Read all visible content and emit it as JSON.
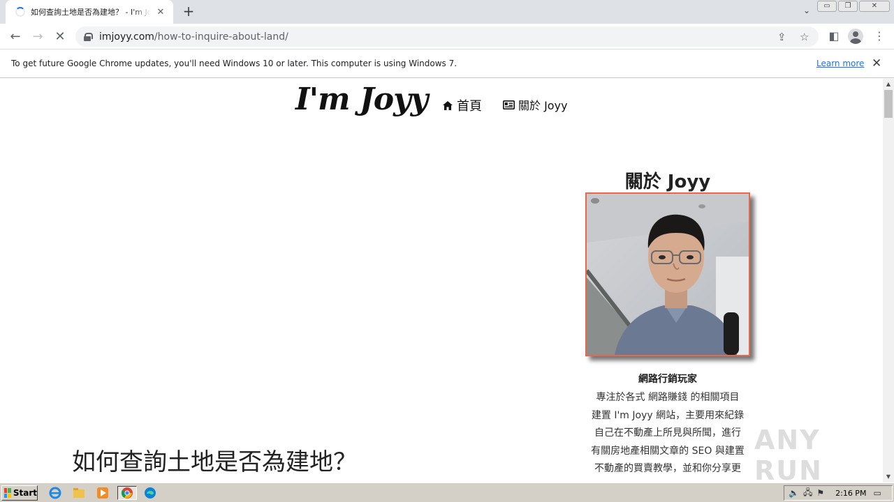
{
  "browser": {
    "tab_title": "如何查詢土地是否為建地？ - I'm Joyy",
    "tab_close": "✕",
    "new_tab": "+",
    "url_domain": "imjoyy.com",
    "url_path": "/how-to-inquire-about-land/"
  },
  "infobar": {
    "message": "To get future Google Chrome updates, you'll need Windows 10 or later. This computer is using Windows 7.",
    "learn_more": "Learn more",
    "close": "✕"
  },
  "site": {
    "logo": "I'm Joyy",
    "nav": [
      {
        "label": "首頁",
        "icon": "home-icon"
      },
      {
        "label": "關於 Joyy",
        "icon": "id-card-icon"
      }
    ]
  },
  "sidebar": {
    "title": "關於 Joyy",
    "role": "網路行銷玩家",
    "lines": [
      "專注於各式 網路賺錢 的相關項目",
      "建置 I'm Joyy 網站，主要用來紀錄",
      "自己在不動產上所見與所聞，進行",
      "有關房地產相關文章的 SEO 與建置",
      "不動產的買賣教學，並和你分享更"
    ]
  },
  "post": {
    "title": "如何查詢土地是否為建地？"
  },
  "watermark": "ANY RUN",
  "taskbar": {
    "start": "Start",
    "time": "2:16 PM"
  },
  "colors": {
    "photo_border": "#e8694a",
    "link": "#1a73e8",
    "taskbar": "#d4d0c8"
  }
}
